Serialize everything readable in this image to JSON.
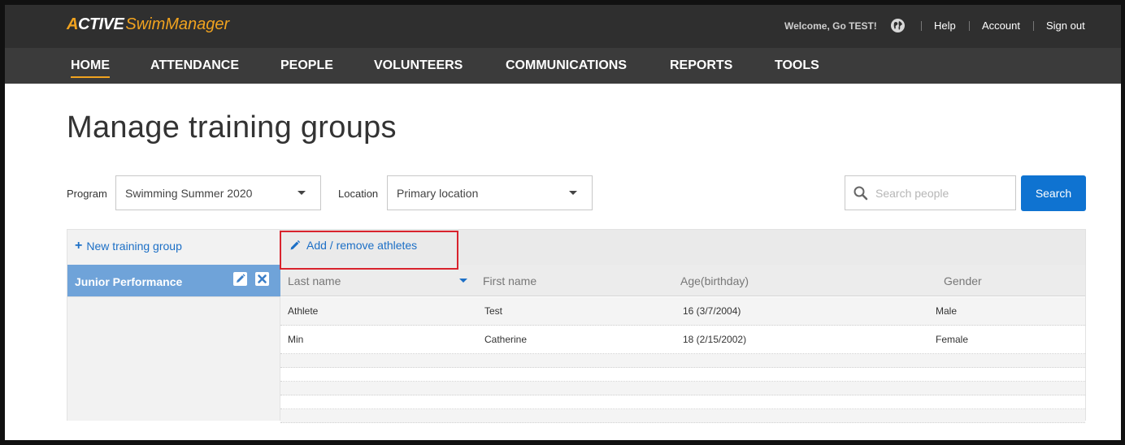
{
  "brand": {
    "logo_active": "CTIVE",
    "logo_a": "A",
    "logo_product": "SwimManager",
    "accent_color": "#f1a31f"
  },
  "utility": {
    "welcome": "Welcome, Go TEST!",
    "globe_icon": "globe-icon",
    "help": "Help",
    "account": "Account",
    "sign_out": "Sign out"
  },
  "nav": {
    "items": [
      "HOME",
      "ATTENDANCE",
      "PEOPLE",
      "VOLUNTEERS",
      "COMMUNICATIONS",
      "REPORTS",
      "TOOLS"
    ],
    "active": "HOME"
  },
  "page": {
    "title": "Manage training groups"
  },
  "filters": {
    "program_label": "Program",
    "program_value": "Swimming Summer 2020",
    "location_label": "Location",
    "location_value": "Primary location"
  },
  "search": {
    "placeholder": "Search people",
    "value": "",
    "button": "Search",
    "button_color": "#0f73d1"
  },
  "groups": {
    "new_label": "New training group",
    "items": [
      {
        "name": "Junior Performance",
        "selected": true
      }
    ],
    "selected_color": "#6fa3d9"
  },
  "athletes": {
    "add_remove_label": "Add / remove athletes",
    "columns": [
      "Last name",
      "First name",
      "Age(birthday)",
      "Gender"
    ],
    "sorted_by": "Last name",
    "rows": [
      {
        "last": "Athlete",
        "first": "Test",
        "age": "16 (3/7/2004)",
        "gender": "Male"
      },
      {
        "last": "Min",
        "first": "Catherine",
        "age": "18 (2/15/2002)",
        "gender": "Female"
      }
    ]
  }
}
